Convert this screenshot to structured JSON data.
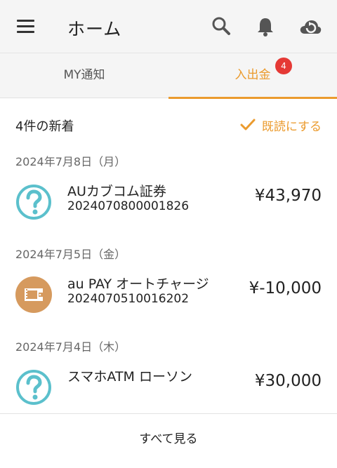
{
  "appbar": {
    "title": "ホーム",
    "icons": [
      "menu-icon",
      "search-icon",
      "bell-icon",
      "cloud-sync-icon"
    ]
  },
  "tabs": [
    {
      "label": "MY通知",
      "active": false
    },
    {
      "label": "入出金",
      "active": true,
      "badge": "4"
    }
  ],
  "summary": {
    "new_count": "4件の新着",
    "mark_read": "既読にする"
  },
  "groups": [
    {
      "date": "2024年7月8日（月）",
      "items": [
        {
          "name": "AUカブコム証券",
          "ref": "2024070800001826",
          "amount": "¥43,970",
          "icon": "question-icon"
        }
      ]
    },
    {
      "date": "2024年7月5日（金）",
      "items": [
        {
          "name": "au PAY オートチャージ",
          "ref": "2024070510016202",
          "amount": "¥-10,000",
          "icon": "wallet-icon"
        }
      ]
    },
    {
      "date": "2024年7月4日（木）",
      "items": [
        {
          "name": "スマホATM ローソン",
          "ref": "",
          "amount": "¥30,000",
          "icon": "question-icon"
        }
      ]
    }
  ],
  "footer": {
    "see_all": "すべて見る"
  },
  "colors": {
    "accent": "#eb9b2e",
    "badge": "#e53935",
    "teal": "#5bc0cc",
    "wallet": "#d69a5e"
  }
}
